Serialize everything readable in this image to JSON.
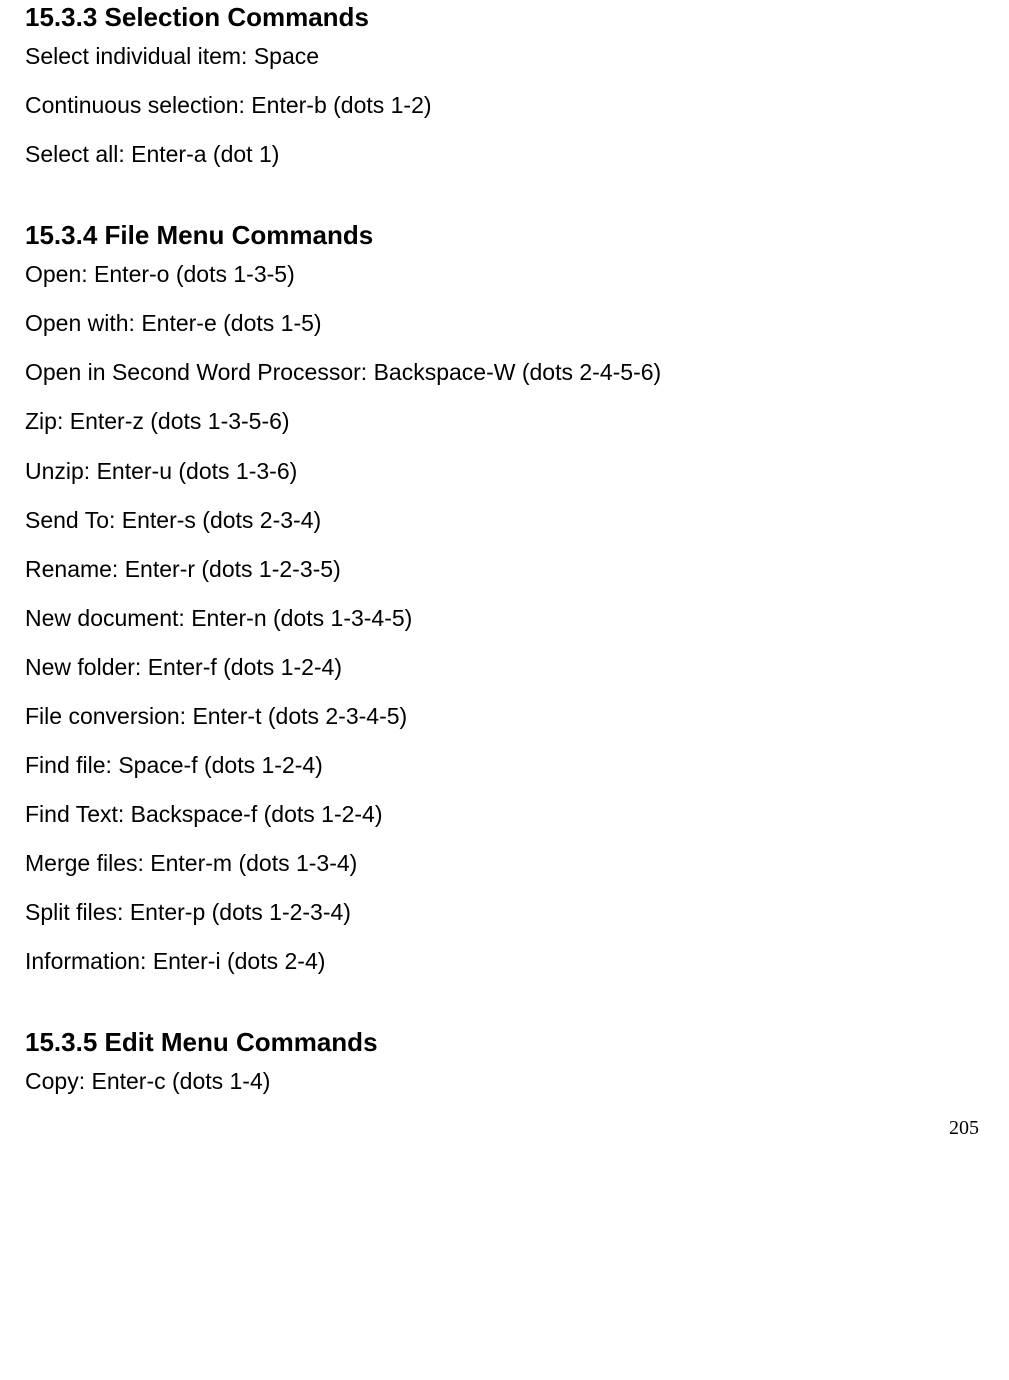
{
  "sections": [
    {
      "heading": "15.3.3 Selection Commands",
      "items": [
        "Select individual item: Space",
        "Continuous selection: Enter-b (dots 1-2)",
        "Select all: Enter-a (dot 1)"
      ]
    },
    {
      "heading": "15.3.4 File Menu Commands",
      "items": [
        "Open: Enter-o (dots 1-3-5)",
        "Open with: Enter-e (dots 1-5)",
        "Open in Second Word Processor: Backspace-W (dots 2-4-5-6)",
        "Zip: Enter-z (dots 1-3-5-6)",
        "Unzip: Enter-u (dots 1-3-6)",
        "Send To: Enter-s (dots 2-3-4)",
        "Rename: Enter-r (dots 1-2-3-5)",
        "New document: Enter-n (dots 1-3-4-5)",
        "New folder: Enter-f (dots 1-2-4)",
        "File conversion: Enter-t (dots 2-3-4-5)",
        "Find file: Space-f (dots 1-2-4)",
        "Find Text: Backspace-f (dots 1-2-4)",
        " Merge files: Enter-m (dots 1-3-4)",
        "Split files: Enter-p (dots 1-2-3-4)",
        "Information: Enter-i (dots 2-4)"
      ]
    },
    {
      "heading": "15.3.5 Edit Menu Commands",
      "items": [
        "Copy: Enter-c (dots 1-4)"
      ]
    }
  ],
  "page_number": "205"
}
